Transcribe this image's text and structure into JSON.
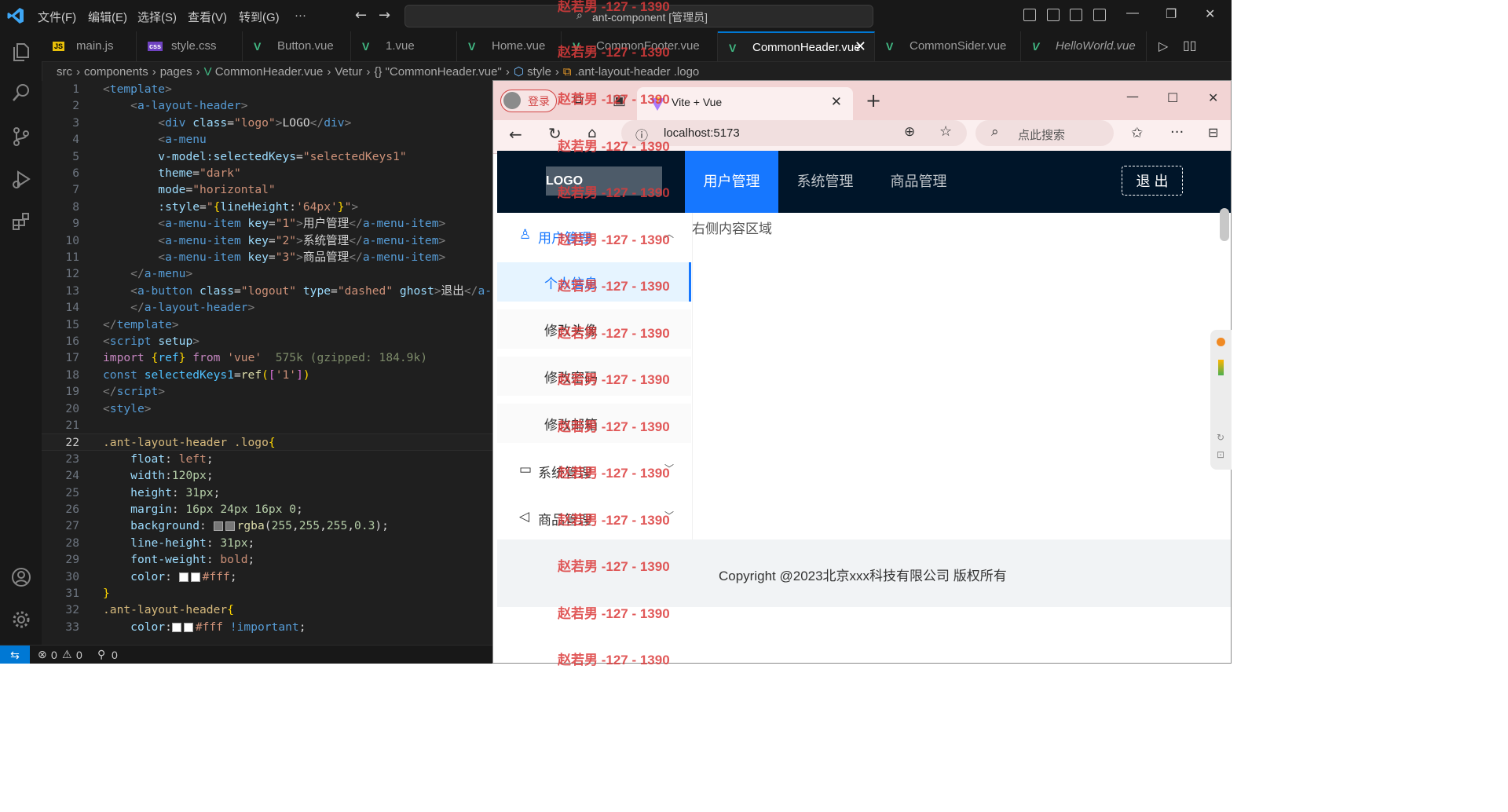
{
  "vscode": {
    "menu": [
      "文件(F)",
      "编辑(E)",
      "选择(S)",
      "查看(V)",
      "转到(G)",
      "···"
    ],
    "command_center": "ant-component [管理员]",
    "tabs": [
      {
        "label": "main.js",
        "type": "js"
      },
      {
        "label": "style.css",
        "type": "css"
      },
      {
        "label": "Button.vue",
        "type": "vue"
      },
      {
        "label": "1.vue",
        "type": "vue"
      },
      {
        "label": "Home.vue",
        "type": "vue"
      },
      {
        "label": "CommonFooter.vue",
        "type": "vue"
      },
      {
        "label": "CommonHeader.vue",
        "type": "vue",
        "active": true
      },
      {
        "label": "CommonSider.vue",
        "type": "vue"
      },
      {
        "label": "HelloWorld.vue",
        "type": "vue"
      }
    ],
    "breadcrumb": [
      "src",
      "components",
      "pages",
      "CommonHeader.vue",
      "Vetur",
      "{} \"CommonHeader.vue\"",
      "style",
      ".ant-layout-header .logo"
    ],
    "status": {
      "errors": "0",
      "warnings": "0",
      "ports": "0"
    }
  },
  "code_lines": [
    {
      "n": "1"
    },
    {
      "n": "2"
    },
    {
      "n": "3"
    },
    {
      "n": "4"
    },
    {
      "n": "5"
    },
    {
      "n": "6"
    },
    {
      "n": "7"
    },
    {
      "n": "8"
    },
    {
      "n": "9"
    },
    {
      "n": "10"
    },
    {
      "n": "11"
    },
    {
      "n": "12"
    },
    {
      "n": "13"
    },
    {
      "n": "14"
    },
    {
      "n": "15"
    },
    {
      "n": "16"
    },
    {
      "n": "17"
    },
    {
      "n": "18"
    },
    {
      "n": "19"
    },
    {
      "n": "20"
    },
    {
      "n": "21"
    },
    {
      "n": "22"
    },
    {
      "n": "23"
    },
    {
      "n": "24"
    },
    {
      "n": "25"
    },
    {
      "n": "26"
    },
    {
      "n": "27"
    },
    {
      "n": "28"
    },
    {
      "n": "29"
    },
    {
      "n": "30"
    },
    {
      "n": "31"
    },
    {
      "n": "32"
    },
    {
      "n": "33"
    }
  ],
  "browser": {
    "profile_label": "登录",
    "tab_title": "Vite + Vue",
    "url": "localhost:5173",
    "search_placeholder": "点此搜索"
  },
  "app": {
    "logo": "LOGO",
    "menu": [
      "用户管理",
      "系统管理",
      "商品管理"
    ],
    "logout": "退 出",
    "sider": {
      "user_mgmt": "用户管理",
      "items": [
        "个人信息",
        "修改头像",
        "修改密码",
        "修改邮箱"
      ],
      "system_mgmt": "系统管理",
      "goods_mgmt": "商品管理"
    },
    "content": "右侧内容区域",
    "footer": "Copyright @2023北京xxx科技有限公司 版权所有"
  },
  "watermark": "赵若男 -127 - 1390",
  "colors": {
    "antd_primary": "#1677ff",
    "header_bg": "#001529",
    "vscode_accent": "#0078d4",
    "watermark": "#dc3c3c"
  }
}
